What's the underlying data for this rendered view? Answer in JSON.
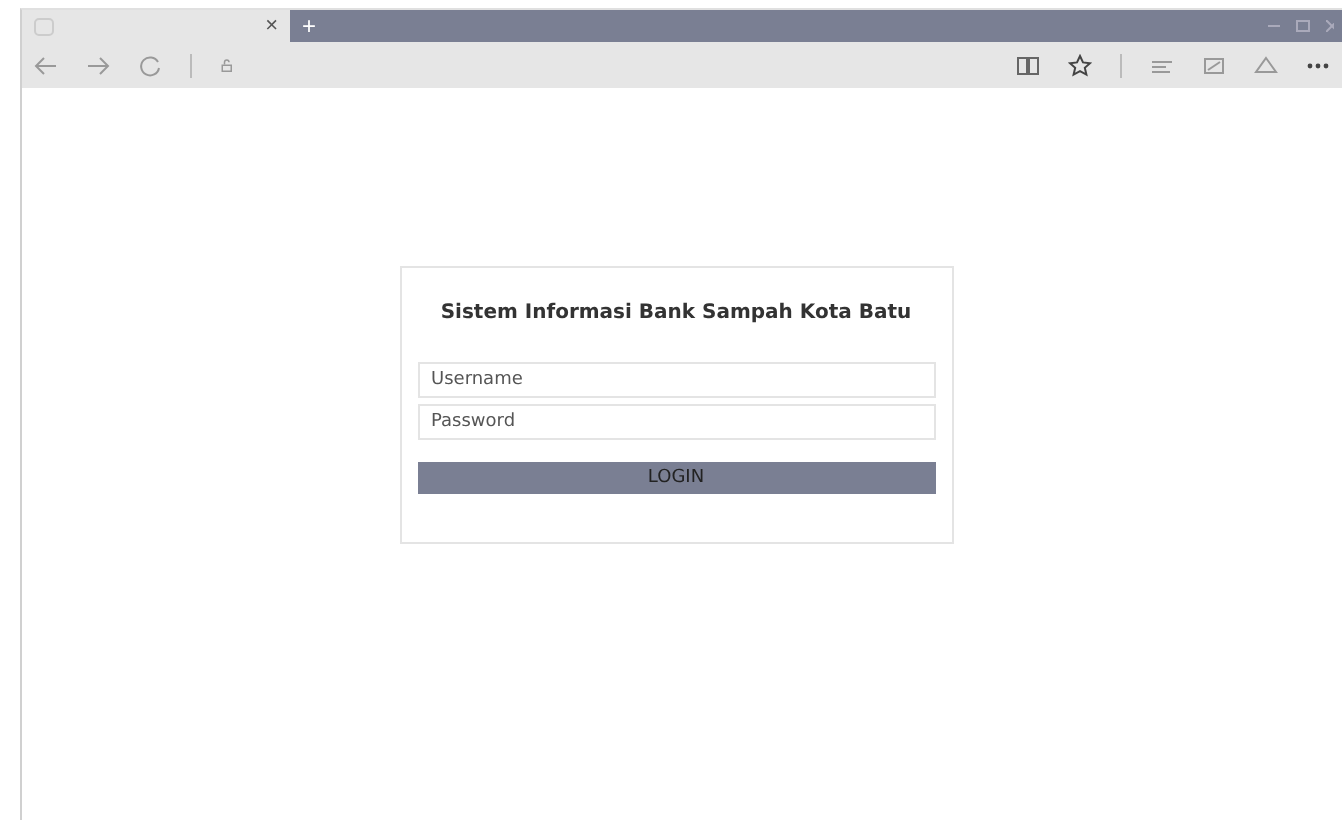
{
  "browser": {
    "tab": {
      "close": "×",
      "selected": true
    },
    "new_tab": "+"
  },
  "login": {
    "title": "Sistem Informasi Bank Sampah Kota Batu",
    "fields": [
      {
        "placeholder": "Username"
      },
      {
        "placeholder": "Password"
      }
    ],
    "button": "LOGIN"
  }
}
